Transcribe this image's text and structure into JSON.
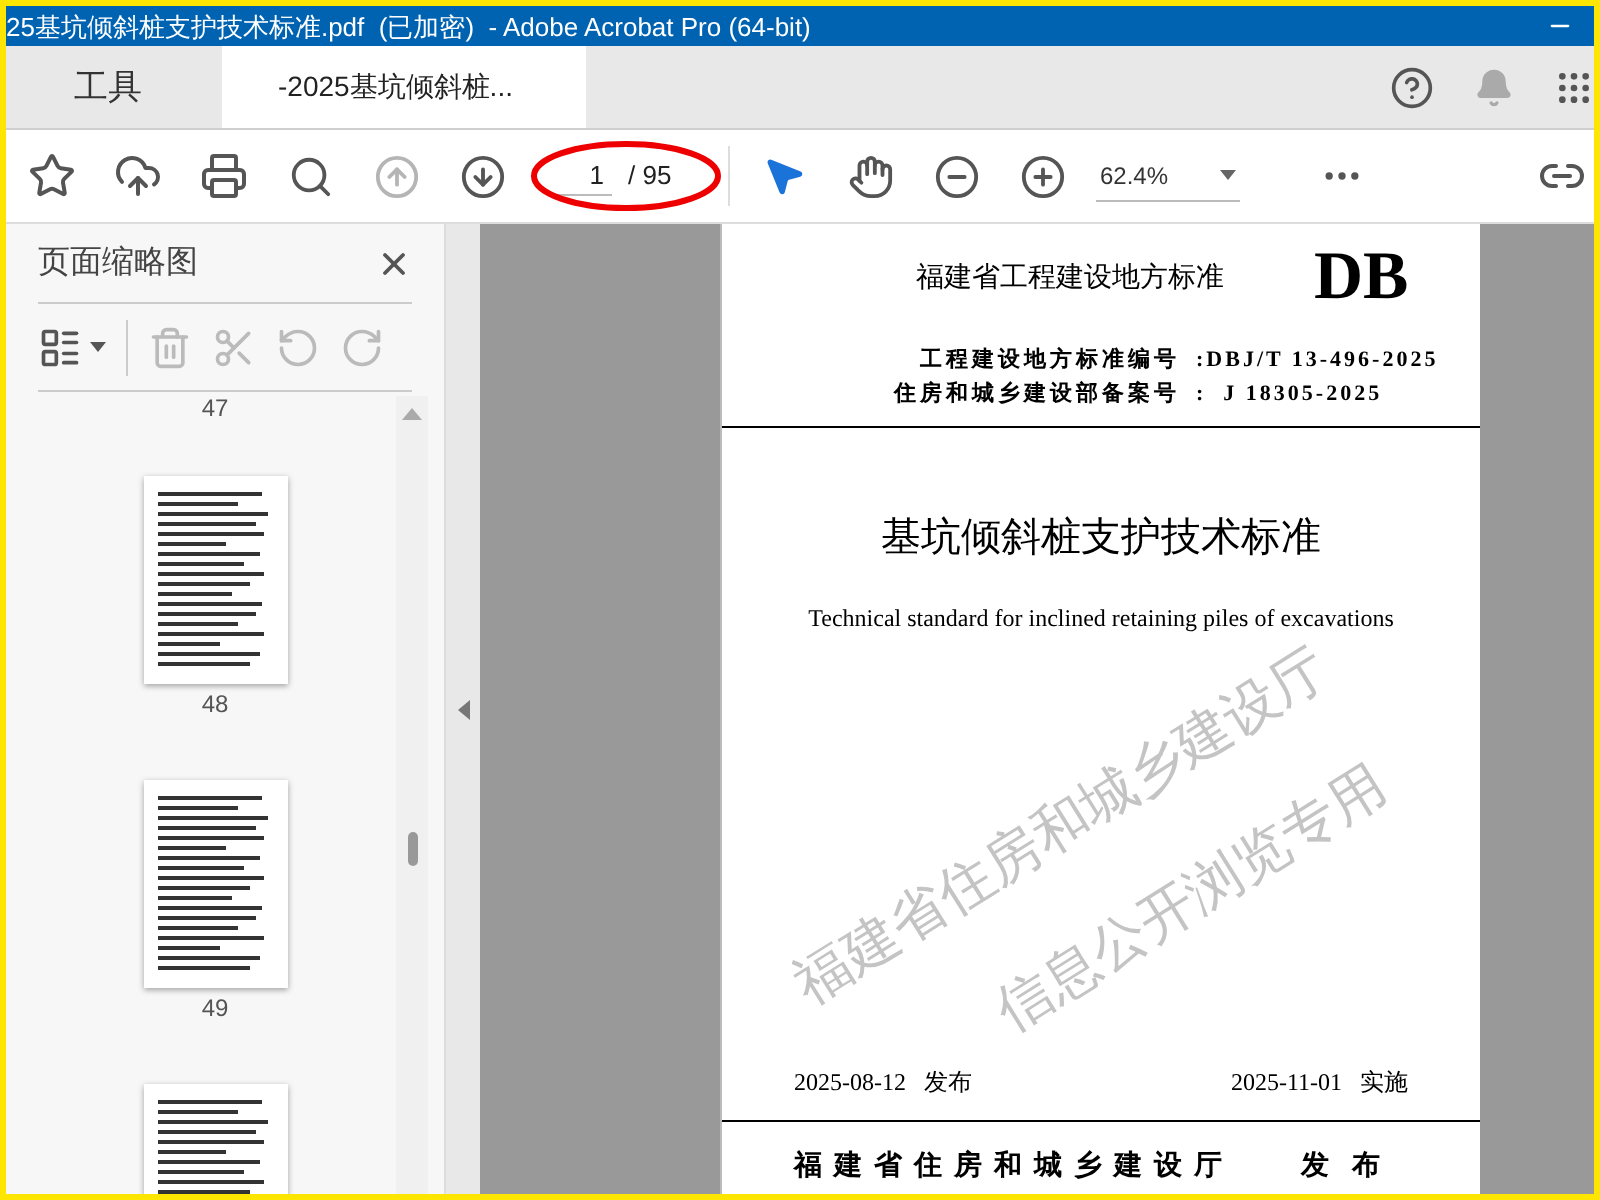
{
  "window": {
    "title": "25基坑倾斜桩支护技术标准.pdf  (已加密)  - Adobe Acrobat Pro (64-bit)"
  },
  "tabs": [
    {
      "label": "工具",
      "selected": false
    },
    {
      "label": "-2025基坑倾斜桩...",
      "selected": true
    }
  ],
  "toolbar": {
    "page_current": "1",
    "page_total": "/ 95",
    "zoom": "62.4%"
  },
  "thumbnail_panel": {
    "title": "页面缩略图",
    "items": [
      {
        "kind": "label",
        "text": "47"
      },
      {
        "kind": "thumbnail"
      },
      {
        "kind": "label",
        "text": "48"
      },
      {
        "kind": "thumbnail"
      },
      {
        "kind": "label",
        "text": "49"
      },
      {
        "kind": "thumbnail"
      }
    ]
  },
  "document": {
    "header": "福建省工程建设地方标准",
    "badge": "DB",
    "codes": [
      {
        "label": "工程建设地方标准编号",
        "value": ":DBJ/T 13-496-2025"
      },
      {
        "label": "住房和城乡建设部备案号",
        "value": ":  J 18305-2025"
      }
    ],
    "title": "基坑倾斜桩支护技术标准",
    "subtitle": "Technical standard for inclined retaining piles of excavations",
    "issue_date": "2025-08-12",
    "issue_label": "发布",
    "effective_date": "2025-11-01",
    "effective_label": "实施",
    "publisher": "福建省住房和城乡建设厅",
    "publish_label": "发 布",
    "watermark_lines": [
      "福建省住房和城乡建设厅",
      "信息公开浏览专用"
    ]
  }
}
